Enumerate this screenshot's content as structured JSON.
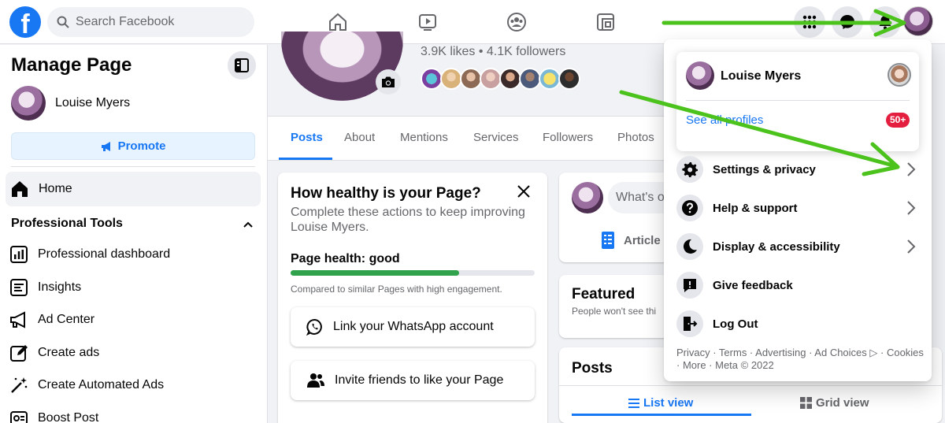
{
  "topbar": {
    "logo": "f",
    "search_placeholder": "Search Facebook"
  },
  "sidebar": {
    "title": "Manage Page",
    "page_name": "Louise Myers",
    "promote_label": "Promote",
    "home_label": "Home",
    "section_title": "Professional Tools",
    "items": [
      {
        "label": "Professional dashboard",
        "icon": "dashboard-icon"
      },
      {
        "label": "Insights",
        "icon": "insights-icon"
      },
      {
        "label": "Ad Center",
        "icon": "megaphone-icon"
      },
      {
        "label": "Create ads",
        "icon": "edit-icon"
      },
      {
        "label": "Create Automated Ads",
        "icon": "magic-wand-icon"
      },
      {
        "label": "Boost Post",
        "icon": "boost-icon"
      }
    ]
  },
  "page": {
    "stats": "3.9K likes • 4.1K followers",
    "tabs": [
      "Posts",
      "About",
      "Mentions",
      "Services",
      "Followers",
      "Photos"
    ],
    "active_tab": "Posts"
  },
  "health": {
    "title": "How healthy is your Page?",
    "subtitle": "Complete these actions to keep improving Louise Myers.",
    "label": "Page health: good",
    "progress": 0.69,
    "comparison": "Compared to similar Pages with high engagement.",
    "actions": [
      {
        "label": "Link your WhatsApp account",
        "icon": "whatsapp-icon"
      },
      {
        "label": "Invite friends to like your Page",
        "icon": "friends-icon"
      }
    ]
  },
  "composer": {
    "placeholder": "What's o",
    "article_label": "Article"
  },
  "featured": {
    "title": "Featured",
    "subtitle": "People won't see thi"
  },
  "posts": {
    "title": "Posts",
    "list_view": "List view",
    "grid_view": "Grid view"
  },
  "menu": {
    "profile_name": "Louise Myers",
    "see_all": "See all profiles",
    "badge": "50+",
    "items": [
      {
        "label": "Settings & privacy",
        "icon": "gear-icon",
        "chevron": true
      },
      {
        "label": "Help & support",
        "icon": "question-icon",
        "chevron": true
      },
      {
        "label": "Display & accessibility",
        "icon": "moon-icon",
        "chevron": true
      },
      {
        "label": "Give feedback",
        "icon": "feedback-icon",
        "chevron": false
      },
      {
        "label": "Log Out",
        "icon": "logout-icon",
        "chevron": false
      }
    ],
    "footer": "Privacy · Terms · Advertising · Ad Choices ▷ · Cookies · More · Meta © 2022"
  },
  "colors": {
    "brand": "#1877f2",
    "health": "#31a24c",
    "badge": "#e41e3f",
    "annotation_arrow": "#4cc21c"
  }
}
